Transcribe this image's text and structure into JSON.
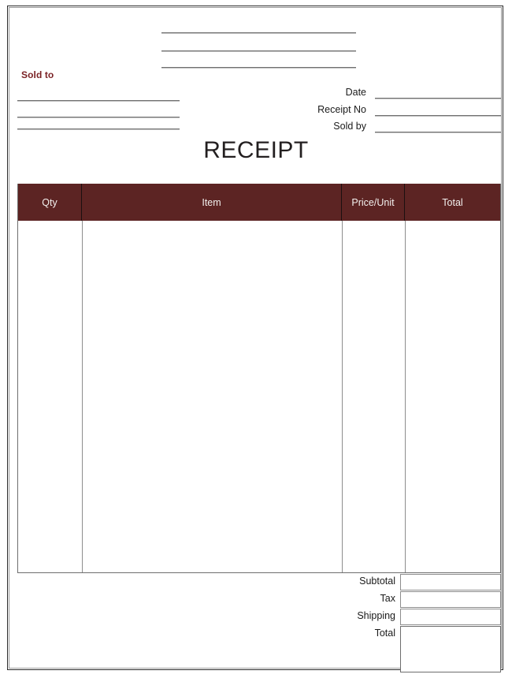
{
  "document": {
    "title": "RECEIPT",
    "accent_color": "#5c2423",
    "label_color": "#7b2225",
    "rule_color": "#8d8d8d"
  },
  "header": {
    "sold_to_label": "Sold to",
    "company_lines": [
      "",
      "",
      ""
    ],
    "sold_to_lines": [
      "",
      "",
      ""
    ],
    "meta": [
      {
        "label": "Date",
        "value": ""
      },
      {
        "label": "Receipt No",
        "value": ""
      },
      {
        "label": "Sold by",
        "value": ""
      }
    ]
  },
  "items_table": {
    "columns": [
      {
        "key": "qty",
        "label": "Qty"
      },
      {
        "key": "item",
        "label": "Item"
      },
      {
        "key": "price",
        "label": "Price/Unit"
      },
      {
        "key": "total",
        "label": "Total"
      }
    ],
    "rows": []
  },
  "summary": {
    "rows": [
      {
        "label": "Subtotal",
        "value": ""
      },
      {
        "label": "Tax",
        "value": ""
      },
      {
        "label": "Shipping",
        "value": ""
      },
      {
        "label": "Total",
        "value": ""
      }
    ]
  }
}
